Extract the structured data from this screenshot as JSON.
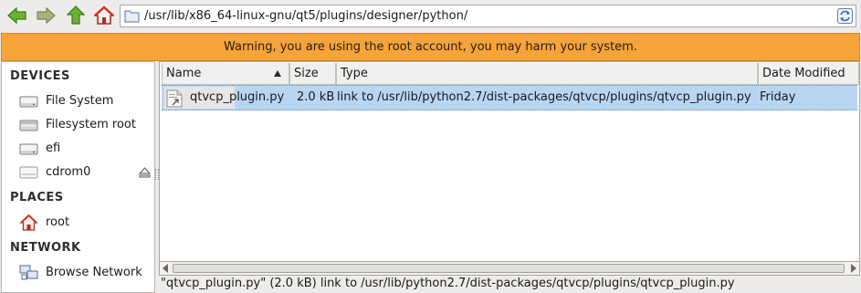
{
  "toolbar": {
    "back_icon": "arrow-left-icon",
    "forward_icon": "arrow-right-icon",
    "up_icon": "arrow-up-icon",
    "home_icon": "home-icon",
    "address": "/usr/lib/x86_64-linux-gnu/qt5/plugins/designer/python/",
    "reload_icon": "reload-icon"
  },
  "warning": {
    "text": "Warning, you are using the root account, you may harm your system."
  },
  "sidebar": {
    "devices_heading": "DEVICES",
    "devices": [
      {
        "label": "File System",
        "icon": "drive-icon"
      },
      {
        "label": "Filesystem root",
        "icon": "drive-icon"
      },
      {
        "label": "efi",
        "icon": "drive-icon"
      },
      {
        "label": "cdrom0",
        "icon": "optical-drive-icon"
      }
    ],
    "places_heading": "PLACES",
    "places": [
      {
        "label": "root",
        "icon": "home-icon"
      }
    ],
    "network_heading": "NETWORK",
    "network": [
      {
        "label": "Browse Network",
        "icon": "network-icon"
      }
    ]
  },
  "filelist": {
    "columns": [
      "Name",
      "Size",
      "Type",
      "Date Modified"
    ],
    "sort_column": "Name",
    "rows": [
      {
        "name": "qtvcp_plugin.py",
        "size": "2.0 kB",
        "type": "link to /usr/lib/python2.7/dist-packages/qtvcp/plugins/qtvcp_plugin.py",
        "modified": "Friday"
      }
    ]
  },
  "status": {
    "text": "\"qtvcp_plugin.py\" (2.0 kB) link to /usr/lib/python2.7/dist-packages/qtvcp/plugins/qtvcp_plugin.py"
  },
  "colors": {
    "warning_bg": "#f5a33a",
    "selection_bg": "#b8d6f2",
    "nav_green": "#5fa32a"
  }
}
